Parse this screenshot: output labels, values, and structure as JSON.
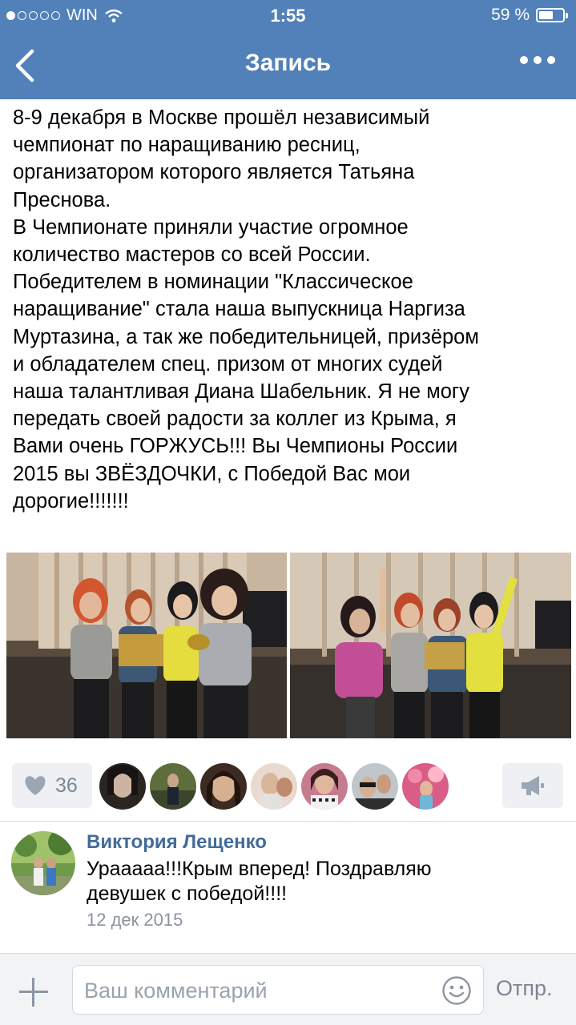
{
  "status": {
    "carrier": "WIN",
    "signal_bars_filled": 1,
    "signal_bars_total": 5,
    "time": "1:55",
    "battery_percent_label": "59 %",
    "battery_level": 0.59
  },
  "nav": {
    "title": "Запись",
    "back_icon": "chevron-left-icon",
    "more_icon": "ellipsis-icon"
  },
  "post": {
    "text": "8-9 декабря в Москве прошёл независимый\nчемпионат по наращиванию ресниц,\nорганизатором которого является Татьяна\nПреснова.\nВ Чемпионате приняли участие огромное\nколичество мастеров со всей России.\nПобедителем в номинации \"Классическое\nнаращивание\" стала наша выпускница Наргиза\nМуртазина, а так же победительницей, призёром\nи обладателем спец. призом от многих судей\nнаша талантливая Диана Шабельник. Я не могу\nпередать своей радости за коллег из Крыма, я\nВами очень ГОРЖУСЬ!!! Вы Чемпионы России\n2015 вы ЗВЁЗДОЧКИ, с Победой Вас мои\nдорогие!!!!!!!",
    "photos": [
      "photo-1",
      "photo-2"
    ]
  },
  "actions": {
    "likes_count": "36",
    "like_icon": "heart-icon",
    "share_icon": "megaphone-icon",
    "liker_avatars": 7
  },
  "comment": {
    "author": "Виктория Лещенко",
    "text": "Урааааа!!!Крым вперед! Поздравляю\nдевушек с победой!!!!",
    "date": "12 дек 2015"
  },
  "composer": {
    "placeholder": "Ваш комментарий",
    "send_label": "Отпр.",
    "add_icon": "plus-icon",
    "emoji_icon": "smile-icon"
  },
  "colors": {
    "nav_bg": "#5181b8",
    "link": "#436b9a",
    "muted": "#8a939e",
    "button_bg": "#eef0f3"
  }
}
